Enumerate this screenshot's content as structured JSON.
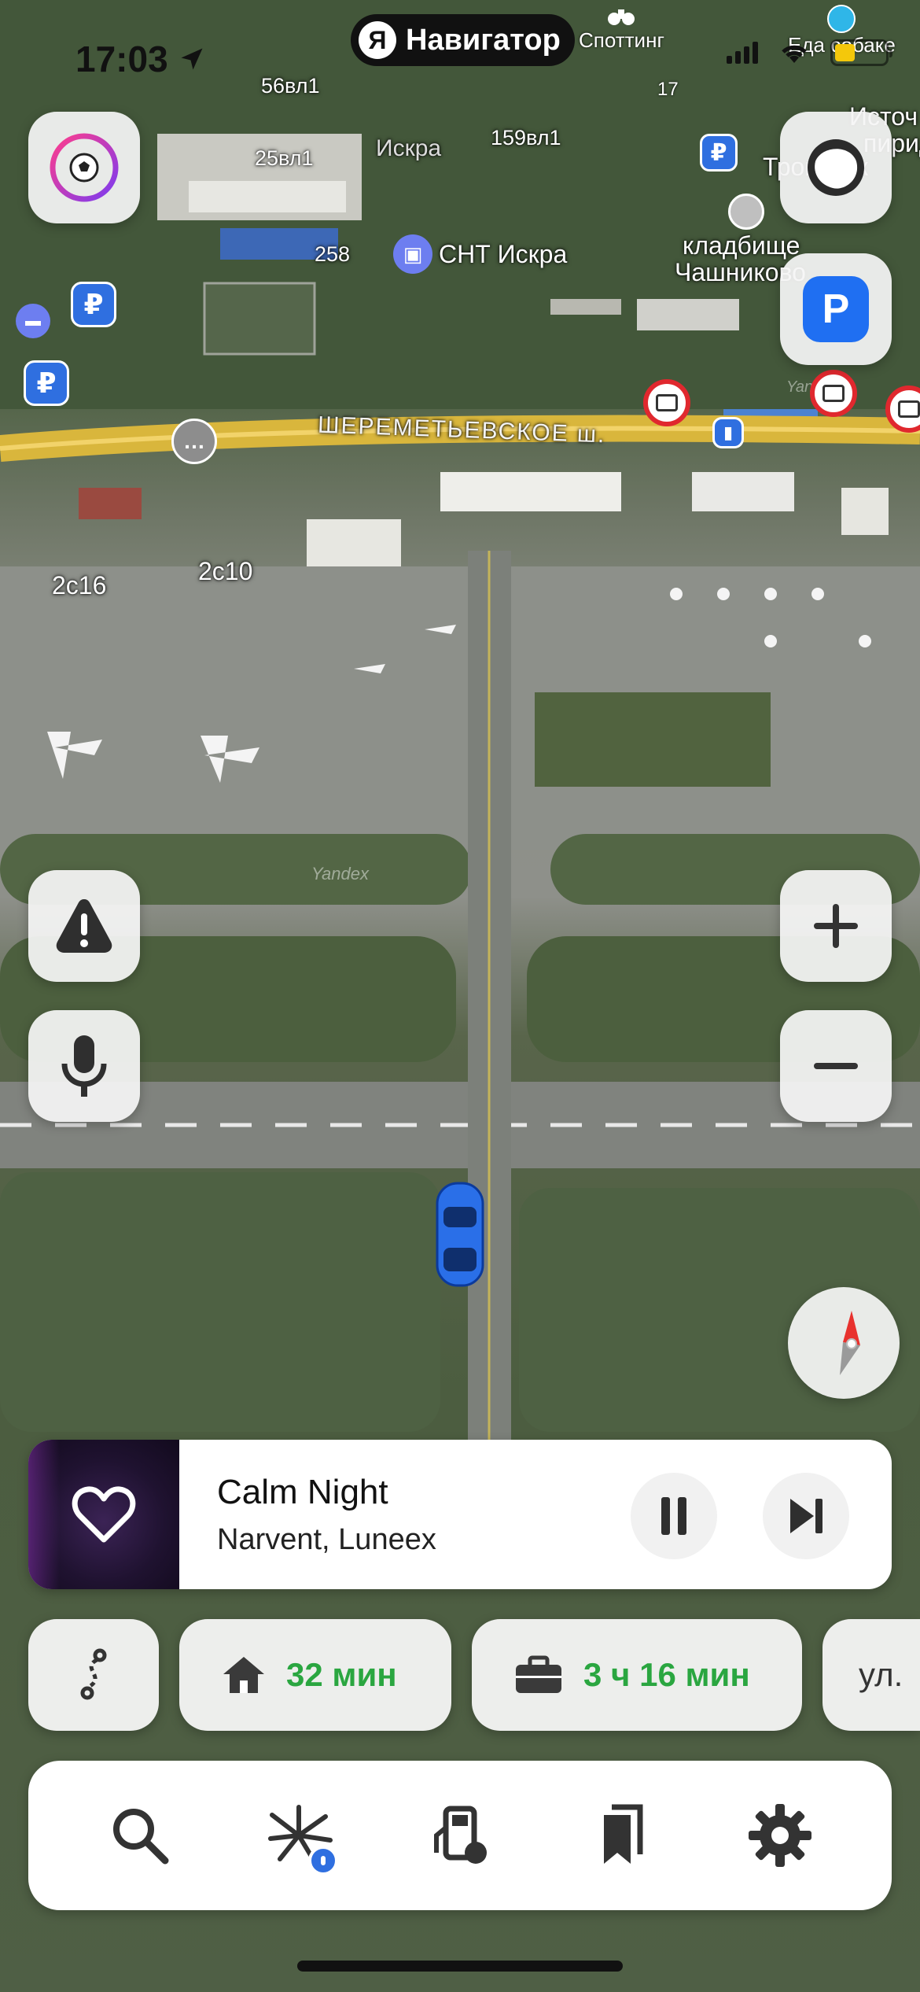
{
  "status_bar": {
    "time": "17:03",
    "battery_level": 0.4,
    "battery_color": "#f4c80b"
  },
  "app_pill": {
    "logo_letter": "Я",
    "title": "Навигатор"
  },
  "top_overlays": {
    "spotting_label": "Споттинг",
    "spotting_count": "17",
    "dog_food_label": "Еда собаке"
  },
  "map": {
    "labels": {
      "building_56": "56вл1",
      "building_25": "25вл1",
      "village_name": "Искра",
      "building_159": "159вл1",
      "number_258": "258",
      "snt_iskra": "СНТ Искра",
      "cemetery_line1": "кладбище",
      "cemetery_line2": "Чашниково",
      "edge_source": "Источ",
      "edge_pirid": "пирид",
      "edge_troitsk": "Троицкск",
      "road_name": "ШЕРЕМЕТЬЕВСКОЕ ш.",
      "building_2c16": "2с16",
      "building_2c10": "2с10",
      "watermark_1": "Yandex",
      "watermark_2": "Yandex"
    },
    "currency_symbol": "₽",
    "parking_letter": "P"
  },
  "controls": {
    "zoom_in_icon": "plus-icon",
    "zoom_out_icon": "minus-icon",
    "report_icon": "alert-triangle-icon",
    "voice_icon": "microphone-icon",
    "compass_icon": "compass-icon",
    "profile_icon": "soccer-ball-icon",
    "alice_icon": "alice-orb-icon",
    "parking_icon": "parking-icon"
  },
  "music": {
    "title": "Calm Night",
    "artist": "Narvent, Luneex",
    "like_icon": "heart-icon",
    "pause_icon": "pause-icon",
    "next_icon": "next-track-icon"
  },
  "routes": {
    "home_time": "32 мин",
    "work_time": "3 ч 16 мин",
    "street_partial": "ул."
  },
  "toolbar": {
    "items": [
      "search-icon",
      "events-icon",
      "gas-station-icon",
      "bookmarks-icon",
      "settings-icon"
    ]
  },
  "colors": {
    "route_green": "#2aa640",
    "accent_blue": "#2f6fe0",
    "camera_red": "#e0282e"
  }
}
